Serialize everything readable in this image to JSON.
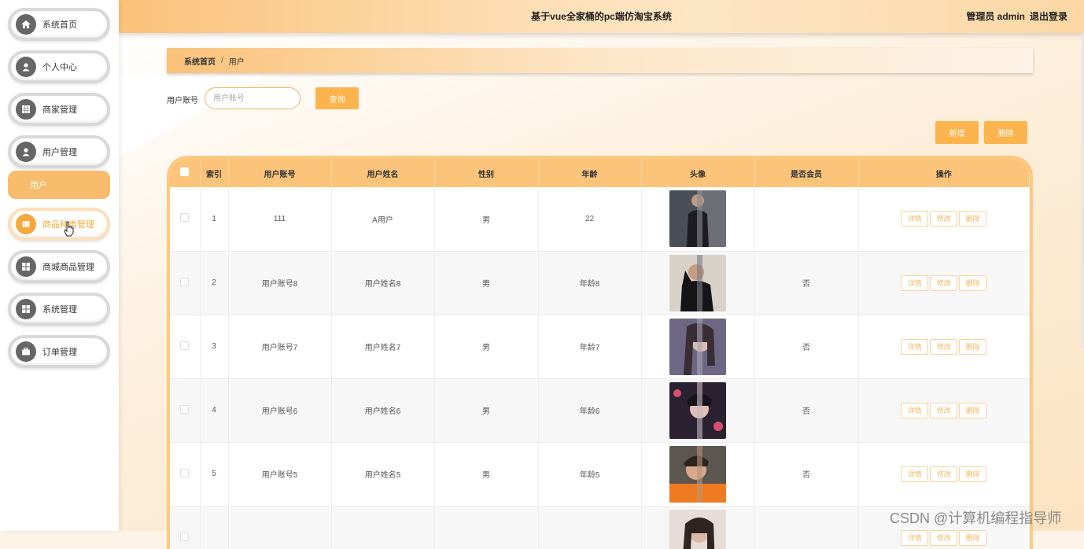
{
  "header": {
    "title": "基于vue全家桶的pc端仿淘宝系统",
    "user": "管理员 admin",
    "logout": "退出登录"
  },
  "sidebar": {
    "items": [
      {
        "label": "系统首页",
        "icon": "home-icon"
      },
      {
        "label": "个人中心",
        "icon": "user-icon"
      },
      {
        "label": "商家管理",
        "icon": "grid-icon"
      },
      {
        "label": "用户管理",
        "icon": "user-icon"
      },
      {
        "label": "商品种类管理",
        "icon": "book-icon"
      },
      {
        "label": "商城商品管理",
        "icon": "apps-icon"
      },
      {
        "label": "系统管理",
        "icon": "apps-icon"
      },
      {
        "label": "订单管理",
        "icon": "briefcase-icon"
      }
    ],
    "sub_item": "用户"
  },
  "breadcrumb": {
    "home": "系统首页",
    "separator": "/",
    "current": "用户"
  },
  "search": {
    "label": "用户账号",
    "placeholder": "用户账号",
    "button": "查询"
  },
  "actions": {
    "add": "新增",
    "delete": "删除"
  },
  "table": {
    "columns": [
      "索引",
      "用户账号",
      "用户姓名",
      "性别",
      "年龄",
      "头像",
      "是否会员",
      "操作"
    ],
    "row_actions": [
      "详情",
      "修改",
      "删除"
    ],
    "rows": [
      {
        "index": "1",
        "account": "111",
        "name": "A用户",
        "gender": "男",
        "age": "22",
        "member": ""
      },
      {
        "index": "2",
        "account": "用户账号8",
        "name": "用户姓名8",
        "gender": "男",
        "age": "年龄8",
        "member": "否"
      },
      {
        "index": "3",
        "account": "用户账号7",
        "name": "用户姓名7",
        "gender": "男",
        "age": "年龄7",
        "member": "否"
      },
      {
        "index": "4",
        "account": "用户账号6",
        "name": "用户姓名6",
        "gender": "男",
        "age": "年龄6",
        "member": "否"
      },
      {
        "index": "5",
        "account": "用户账号5",
        "name": "用户姓名5",
        "gender": "男",
        "age": "年龄5",
        "member": "否"
      },
      {
        "index": "",
        "account": "",
        "name": "",
        "gender": "",
        "age": "",
        "member": ""
      }
    ]
  },
  "watermark": "CSDN @计算机编程指导师",
  "colors": {
    "accent": "#fbb44e",
    "header": "#fbc27a",
    "nav_border": "#d9d9d9"
  }
}
